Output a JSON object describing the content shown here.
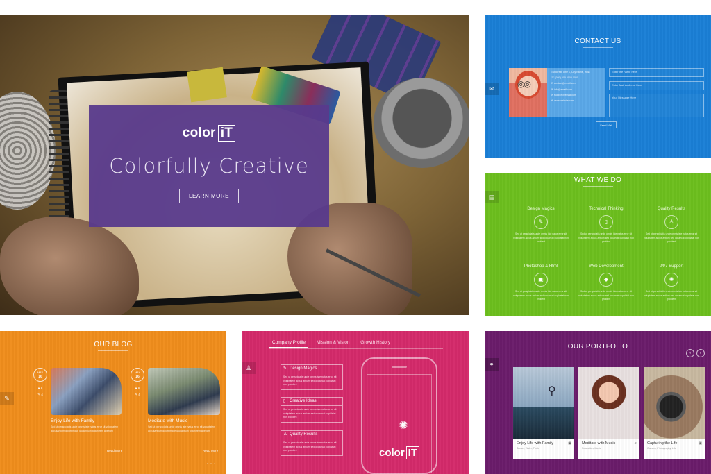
{
  "hero": {
    "logo_text": "color",
    "logo_box": "iT",
    "headline": "Colorfully Creative",
    "cta": "LEARN MORE"
  },
  "contact": {
    "title": "CONTACT US",
    "side_icon": "envelope-icon",
    "info_lines": [
      "Address Line 1, City Name, India",
      "(000) 000 0000 0000",
      "contact@email.com",
      "info@email.com",
      "support@email.com",
      "www.website.com"
    ],
    "name_placeholder": "Enter the name here",
    "email_placeholder": "Enter Mail Address Here",
    "message_placeholder": "Your Message Here",
    "send_label": "Send Mail"
  },
  "whatwedo": {
    "title": "WHAT WE DO",
    "side_icon": "clipboard-icon",
    "desc": "Sed ut perspiciatis unde omnis iste natus error sit voluptatem accus antium sed occaecat cupidatat non proident",
    "services": [
      {
        "name": "Design Magics",
        "icon": "pen-icon"
      },
      {
        "name": "Technical Thinking",
        "icon": "mobile-icon"
      },
      {
        "name": "Quality Results",
        "icon": "person-icon"
      },
      {
        "name": "Photoshop & Html",
        "icon": "image-icon"
      },
      {
        "name": "Web Development",
        "icon": "diamond-icon"
      },
      {
        "name": "24/7 Support",
        "icon": "gear-icon"
      }
    ]
  },
  "blog": {
    "title": "OUR BLOG",
    "side_icon": "pencil-icon",
    "posts": [
      {
        "month": "MAY",
        "day": "16",
        "meta1": "♥ 6",
        "meta2": "✎ 4",
        "title": "Enjoy Life with Family",
        "excerpt": "Sed ut perspiciatis unde omnis iste natus error sit voluptatem accusantium doloremque laudantium totam rem aperiam",
        "read_more": "Read More"
      },
      {
        "month": "MAY",
        "day": "16",
        "meta1": "♥ 6",
        "meta2": "✎ 4",
        "title": "Meditate with Music",
        "excerpt": "Sed ut perspiciatis unde omnis iste natus error sit voluptatem accusantium doloremque laudantium totam rem aperiam",
        "read_more": "Read More"
      }
    ],
    "pager": "• • •"
  },
  "profile": {
    "tabs": [
      "Company Profile",
      "Mission & Vision",
      "Growth History"
    ],
    "side_icon": "user-icon",
    "features": [
      {
        "title": "Design Magics",
        "icon": "✎",
        "desc": "Sed ut perspiciatis unde omnis iste natus error sit voluptatem accus antium sed occaecat cupidatat non proident"
      },
      {
        "title": "Creative Ideas",
        "icon": "▯",
        "desc": "Sed ut perspiciatis unde omnis iste natus error sit voluptatem accus antium sed occaecat cupidatat non proident"
      },
      {
        "title": "Quality Results",
        "icon": "♙",
        "desc": "Sed ut perspiciatis unde omnis iste natus error sit voluptatem accus antium sed occaecat cupidatat non proident"
      }
    ],
    "phone_logo": "color",
    "phone_logo_box": "IT"
  },
  "portfolio": {
    "title": "OUR PORTFOLIO",
    "side_icon": "link-icon",
    "prev": "‹",
    "next": "›",
    "items": [
      {
        "title": "Enjoy Life with Family",
        "sub": "Sunset, Water, Photo",
        "icon": "▣"
      },
      {
        "title": "Meditate with Music",
        "sub": "Relaxation, Music",
        "icon": "♫"
      },
      {
        "title": "Capturing the Life",
        "sub": "Camera, Photography, Life",
        "icon": "▣"
      }
    ]
  },
  "colors": {
    "contact": "#1a7fd6",
    "whatwedo": "#6dbf1e",
    "blog": "#f08d1c",
    "profile": "#d42a6a",
    "portfolio": "#6a1c6a",
    "hero_card": "#583a8c"
  }
}
